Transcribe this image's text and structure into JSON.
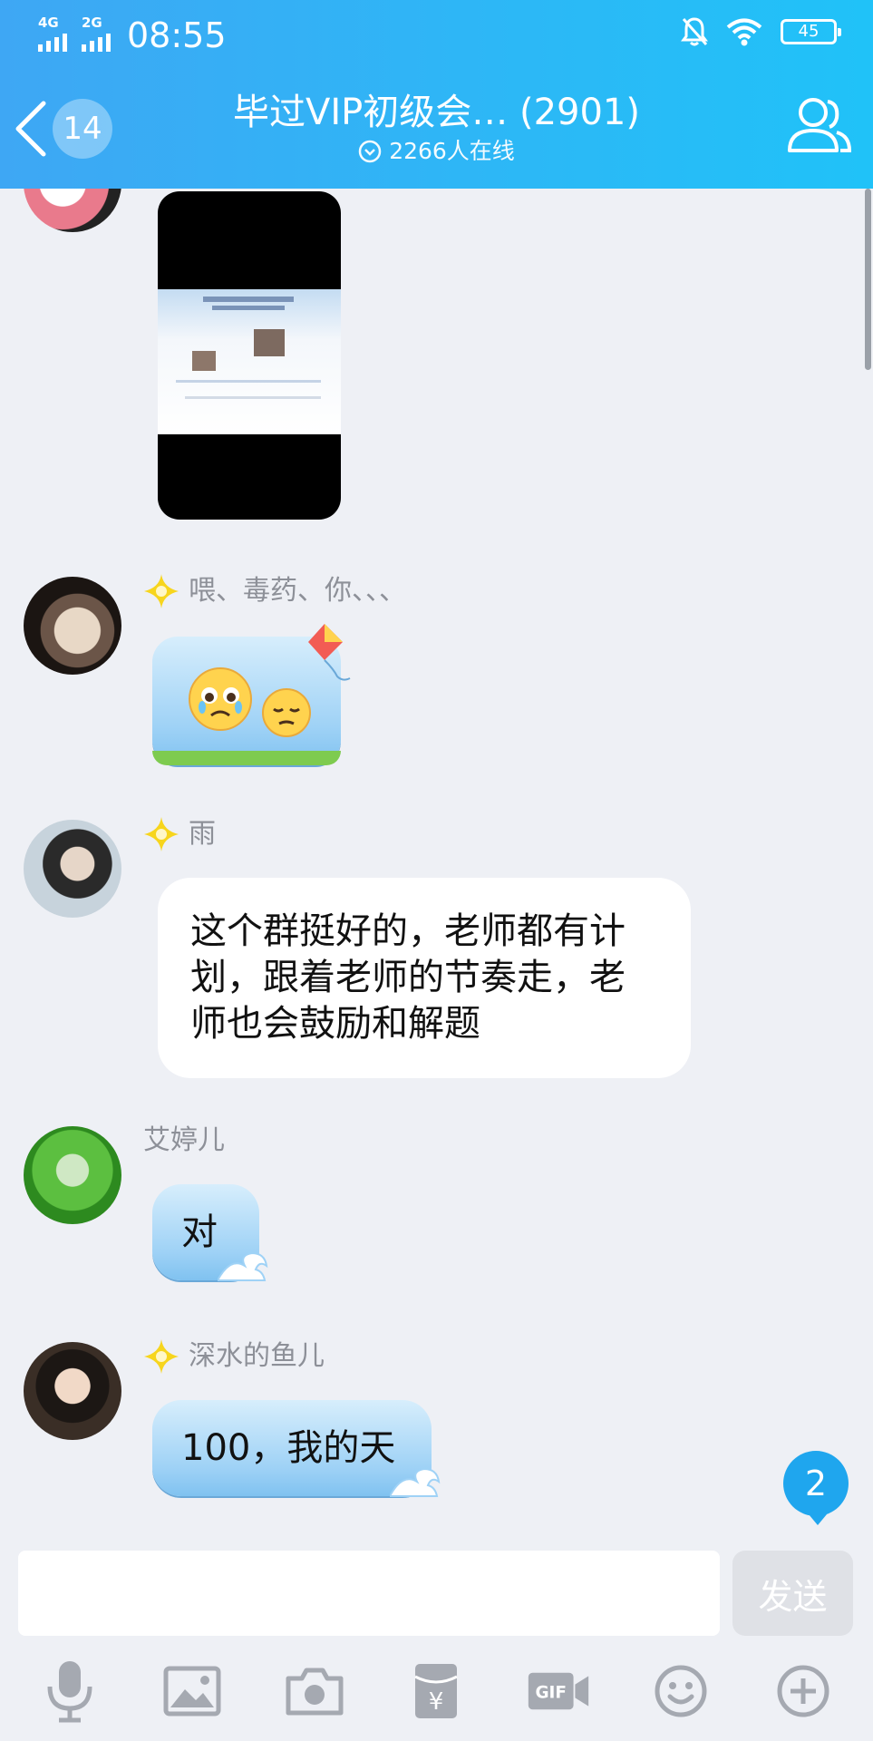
{
  "status_bar": {
    "network_1": "4G",
    "network_2": "2G",
    "time": "08:55",
    "battery": "45"
  },
  "header": {
    "back_count": "14",
    "title": "毕过VIP初级会… (2901)",
    "online": "2266人在线"
  },
  "messages": [
    {
      "type": "image",
      "sender": ""
    },
    {
      "type": "sticker",
      "sender": "喂、毒药、你、、、",
      "badge": "star"
    },
    {
      "type": "text",
      "sender": "雨",
      "badge": "star",
      "text": "这个群挺好的，老师都有计划，跟着老师的节奏走，老师也会鼓励和解题"
    },
    {
      "type": "text",
      "sender": "艾婷儿",
      "text": "对"
    },
    {
      "type": "text",
      "sender": "深水的鱼儿",
      "badge": "star",
      "text": "100，我的天"
    }
  ],
  "unread_count": "2",
  "input": {
    "placeholder": "",
    "value": ""
  },
  "send_label": "发送",
  "toolbar": [
    "microphone-icon",
    "image-icon",
    "camera-icon",
    "red-packet-icon",
    "gif-icon",
    "emoji-icon",
    "plus-icon"
  ],
  "colors": {
    "header": "#2cb8f6",
    "background": "#eef0f5",
    "badge": "#1fa6ee",
    "star": "#f7d51d"
  }
}
